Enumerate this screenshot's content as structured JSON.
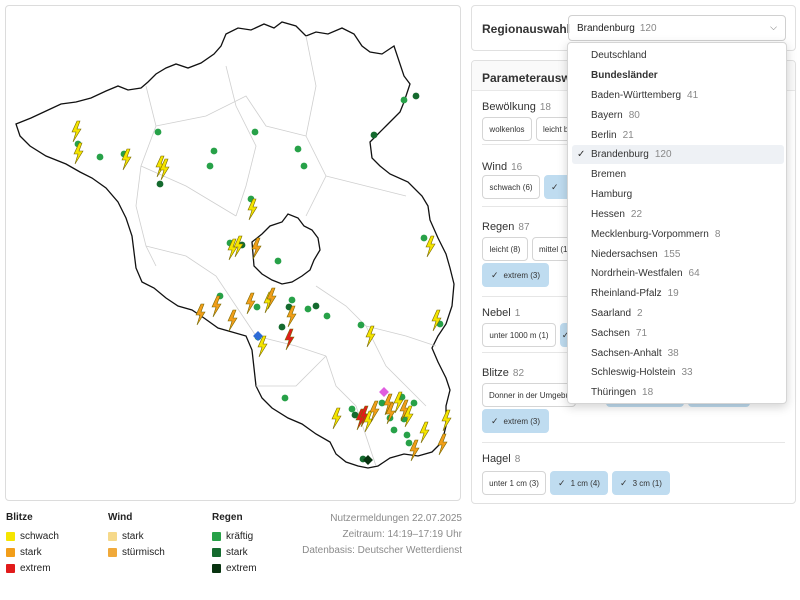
{
  "map": {
    "bolt_colors": {
      "schwach": "#f5e500",
      "stark": "#f29e1a",
      "extrem": "#e11b1b"
    },
    "rain_colors": {
      "kraeftig": "#27a148",
      "stark": "#146a2e",
      "extrem": "#083310"
    },
    "wind_colors": {
      "stark": "#f6d98a",
      "stuermisch": "#f0a93a"
    },
    "symbols": [
      {
        "kind": "bolt",
        "level": "schwach",
        "at": "Nordwesten"
      },
      {
        "kind": "bolt",
        "level": "stark",
        "at": "Südwesten"
      },
      {
        "kind": "bolt",
        "level": "extrem",
        "at": "Zentrum"
      },
      {
        "kind": "rain",
        "level": "kraeftig",
        "at": "verteilt"
      },
      {
        "kind": "rain",
        "level": "stark",
        "at": "Osten"
      }
    ]
  },
  "legend": {
    "blitze": {
      "title": "Blitze",
      "items": [
        {
          "label": "schwach",
          "color": "#f5e500"
        },
        {
          "label": "stark",
          "color": "#f29e1a"
        },
        {
          "label": "extrem",
          "color": "#e11b1b"
        }
      ]
    },
    "wind": {
      "title": "Wind",
      "items": [
        {
          "label": "stark",
          "color": "#f6d98a"
        },
        {
          "label": "stürmisch",
          "color": "#f0a93a"
        }
      ]
    },
    "regen": {
      "title": "Regen",
      "items": [
        {
          "label": "kräftig",
          "color": "#27a148"
        },
        {
          "label": "stark",
          "color": "#146a2e"
        },
        {
          "label": "extrem",
          "color": "#083310"
        }
      ]
    }
  },
  "meta": {
    "line1": "Nutzermeldungen 22.07.2025",
    "line2": "Zeitraum: 14:19–17:19 Uhr",
    "line3": "Datenbasis: Deutscher Wetterdienst"
  },
  "region": {
    "label": "Regionauswahl",
    "selected": "Brandenburg",
    "selected_count": "120",
    "chevron_icon": "chevron-down-icon"
  },
  "params": {
    "title": "Parameterauswahl",
    "groups": [
      {
        "name": "Bewölkung",
        "count": "18",
        "chips": [
          {
            "label": "wolkenlos",
            "selected": false
          },
          {
            "label": "leicht b",
            "selected": false
          }
        ]
      },
      {
        "name": "Wind",
        "count": "16",
        "chips": [
          {
            "label": "schwach (6)",
            "selected": false
          },
          {
            "label": "",
            "selected": true
          }
        ]
      },
      {
        "name": "Regen",
        "count": "87",
        "chips": [
          {
            "label": "leicht (8)",
            "selected": false
          },
          {
            "label": "mittel (1",
            "selected": false
          },
          {
            "label": "extrem (3)",
            "selected": true
          }
        ]
      },
      {
        "name": "Nebel",
        "count": "1",
        "chips": [
          {
            "label": "unter 1000 m (1)",
            "selected": false
          },
          {
            "label": "",
            "selected": true
          }
        ]
      },
      {
        "name": "Blitze",
        "count": "82",
        "chips": [
          {
            "label": "Donner in der Umgebu",
            "selected": false
          },
          {
            "label": "",
            "selected": true
          },
          {
            "label": "",
            "selected": true
          },
          {
            "label": "extrem (3)",
            "selected": true
          }
        ]
      },
      {
        "name": "Hagel",
        "count": "8",
        "chips": [
          {
            "label": "unter 1 cm (3)",
            "selected": false
          },
          {
            "label": "1 cm (4)",
            "selected": true
          },
          {
            "label": "3 cm (1)",
            "selected": true
          }
        ]
      }
    ]
  },
  "dropdown": {
    "items": [
      {
        "label": "Deutschland",
        "count": "",
        "header": false,
        "selected": false
      },
      {
        "label": "Bundesländer",
        "count": "",
        "header": true,
        "selected": false
      },
      {
        "label": "Baden-Württemberg",
        "count": "41",
        "header": false,
        "selected": false
      },
      {
        "label": "Bayern",
        "count": "80",
        "header": false,
        "selected": false
      },
      {
        "label": "Berlin",
        "count": "21",
        "header": false,
        "selected": false
      },
      {
        "label": "Brandenburg",
        "count": "120",
        "header": false,
        "selected": true
      },
      {
        "label": "Bremen",
        "count": "",
        "header": false,
        "selected": false
      },
      {
        "label": "Hamburg",
        "count": "",
        "header": false,
        "selected": false
      },
      {
        "label": "Hessen",
        "count": "22",
        "header": false,
        "selected": false
      },
      {
        "label": "Mecklenburg-Vorpommern",
        "count": "8",
        "header": false,
        "selected": false
      },
      {
        "label": "Niedersachsen",
        "count": "155",
        "header": false,
        "selected": false
      },
      {
        "label": "Nordrhein-Westfalen",
        "count": "64",
        "header": false,
        "selected": false
      },
      {
        "label": "Rheinland-Pfalz",
        "count": "19",
        "header": false,
        "selected": false
      },
      {
        "label": "Saarland",
        "count": "2",
        "header": false,
        "selected": false
      },
      {
        "label": "Sachsen",
        "count": "71",
        "header": false,
        "selected": false
      },
      {
        "label": "Sachsen-Anhalt",
        "count": "38",
        "header": false,
        "selected": false
      },
      {
        "label": "Schleswig-Holstein",
        "count": "33",
        "header": false,
        "selected": false
      },
      {
        "label": "Thüringen",
        "count": "18",
        "header": false,
        "selected": false
      }
    ]
  }
}
